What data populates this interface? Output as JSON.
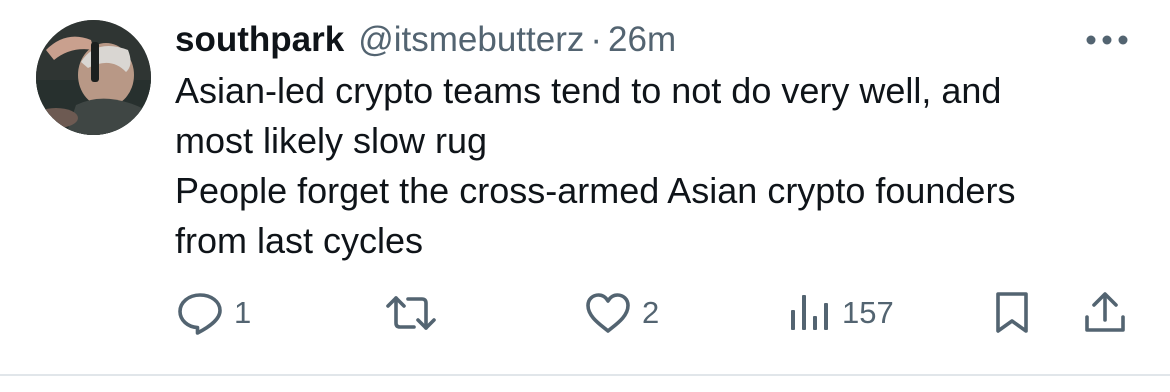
{
  "author": {
    "display_name": "southpark",
    "handle": "@itsmebutterz",
    "separator": "·",
    "time": "26m"
  },
  "tweet": {
    "lines": [
      "Asian-led crypto teams tend to not do very well, and",
      "most likely slow rug",
      "People forget the cross-armed Asian crypto founders",
      "from last cycles"
    ]
  },
  "actions": {
    "reply": {
      "icon": "reply-icon",
      "count": "1"
    },
    "repost": {
      "icon": "repost-icon",
      "count": ""
    },
    "like": {
      "icon": "heart-icon",
      "count": "2"
    },
    "views": {
      "icon": "views-chart-icon",
      "count": "157"
    },
    "bookmark": {
      "icon": "bookmark-icon"
    },
    "share": {
      "icon": "share-icon"
    }
  },
  "colors": {
    "text_primary": "#0f1419",
    "text_secondary": "#536471",
    "divider": "#e1e6ea"
  }
}
